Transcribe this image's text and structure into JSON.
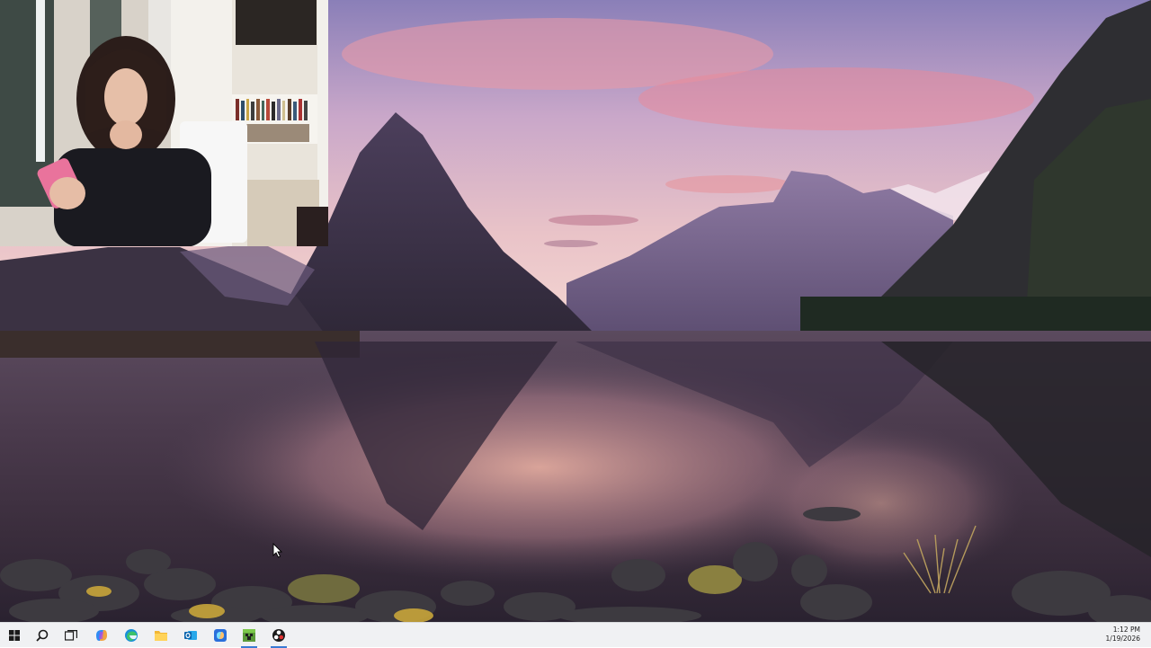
{
  "wallpaper": {
    "description_icon": "landscape-wallpaper"
  },
  "webcam": {
    "icon": "webcam-feed"
  },
  "taskbar": {
    "start_icon": "windows-start-icon",
    "search_icon": "search-icon",
    "task_view_icon": "task-view-icon",
    "apps": [
      {
        "name": "copilot-icon"
      },
      {
        "name": "edge-icon"
      },
      {
        "name": "file-explorer-icon"
      },
      {
        "name": "outlook-icon"
      },
      {
        "name": "copilot-app-icon"
      },
      {
        "name": "minecraft-icon"
      },
      {
        "name": "obs-icon"
      }
    ],
    "clock": {
      "time": "1:12 PM",
      "date": "1/19/2026"
    }
  },
  "colors": {
    "taskbar_bg": "#f0f1f3",
    "active_indicator": "#3a7bd5"
  }
}
